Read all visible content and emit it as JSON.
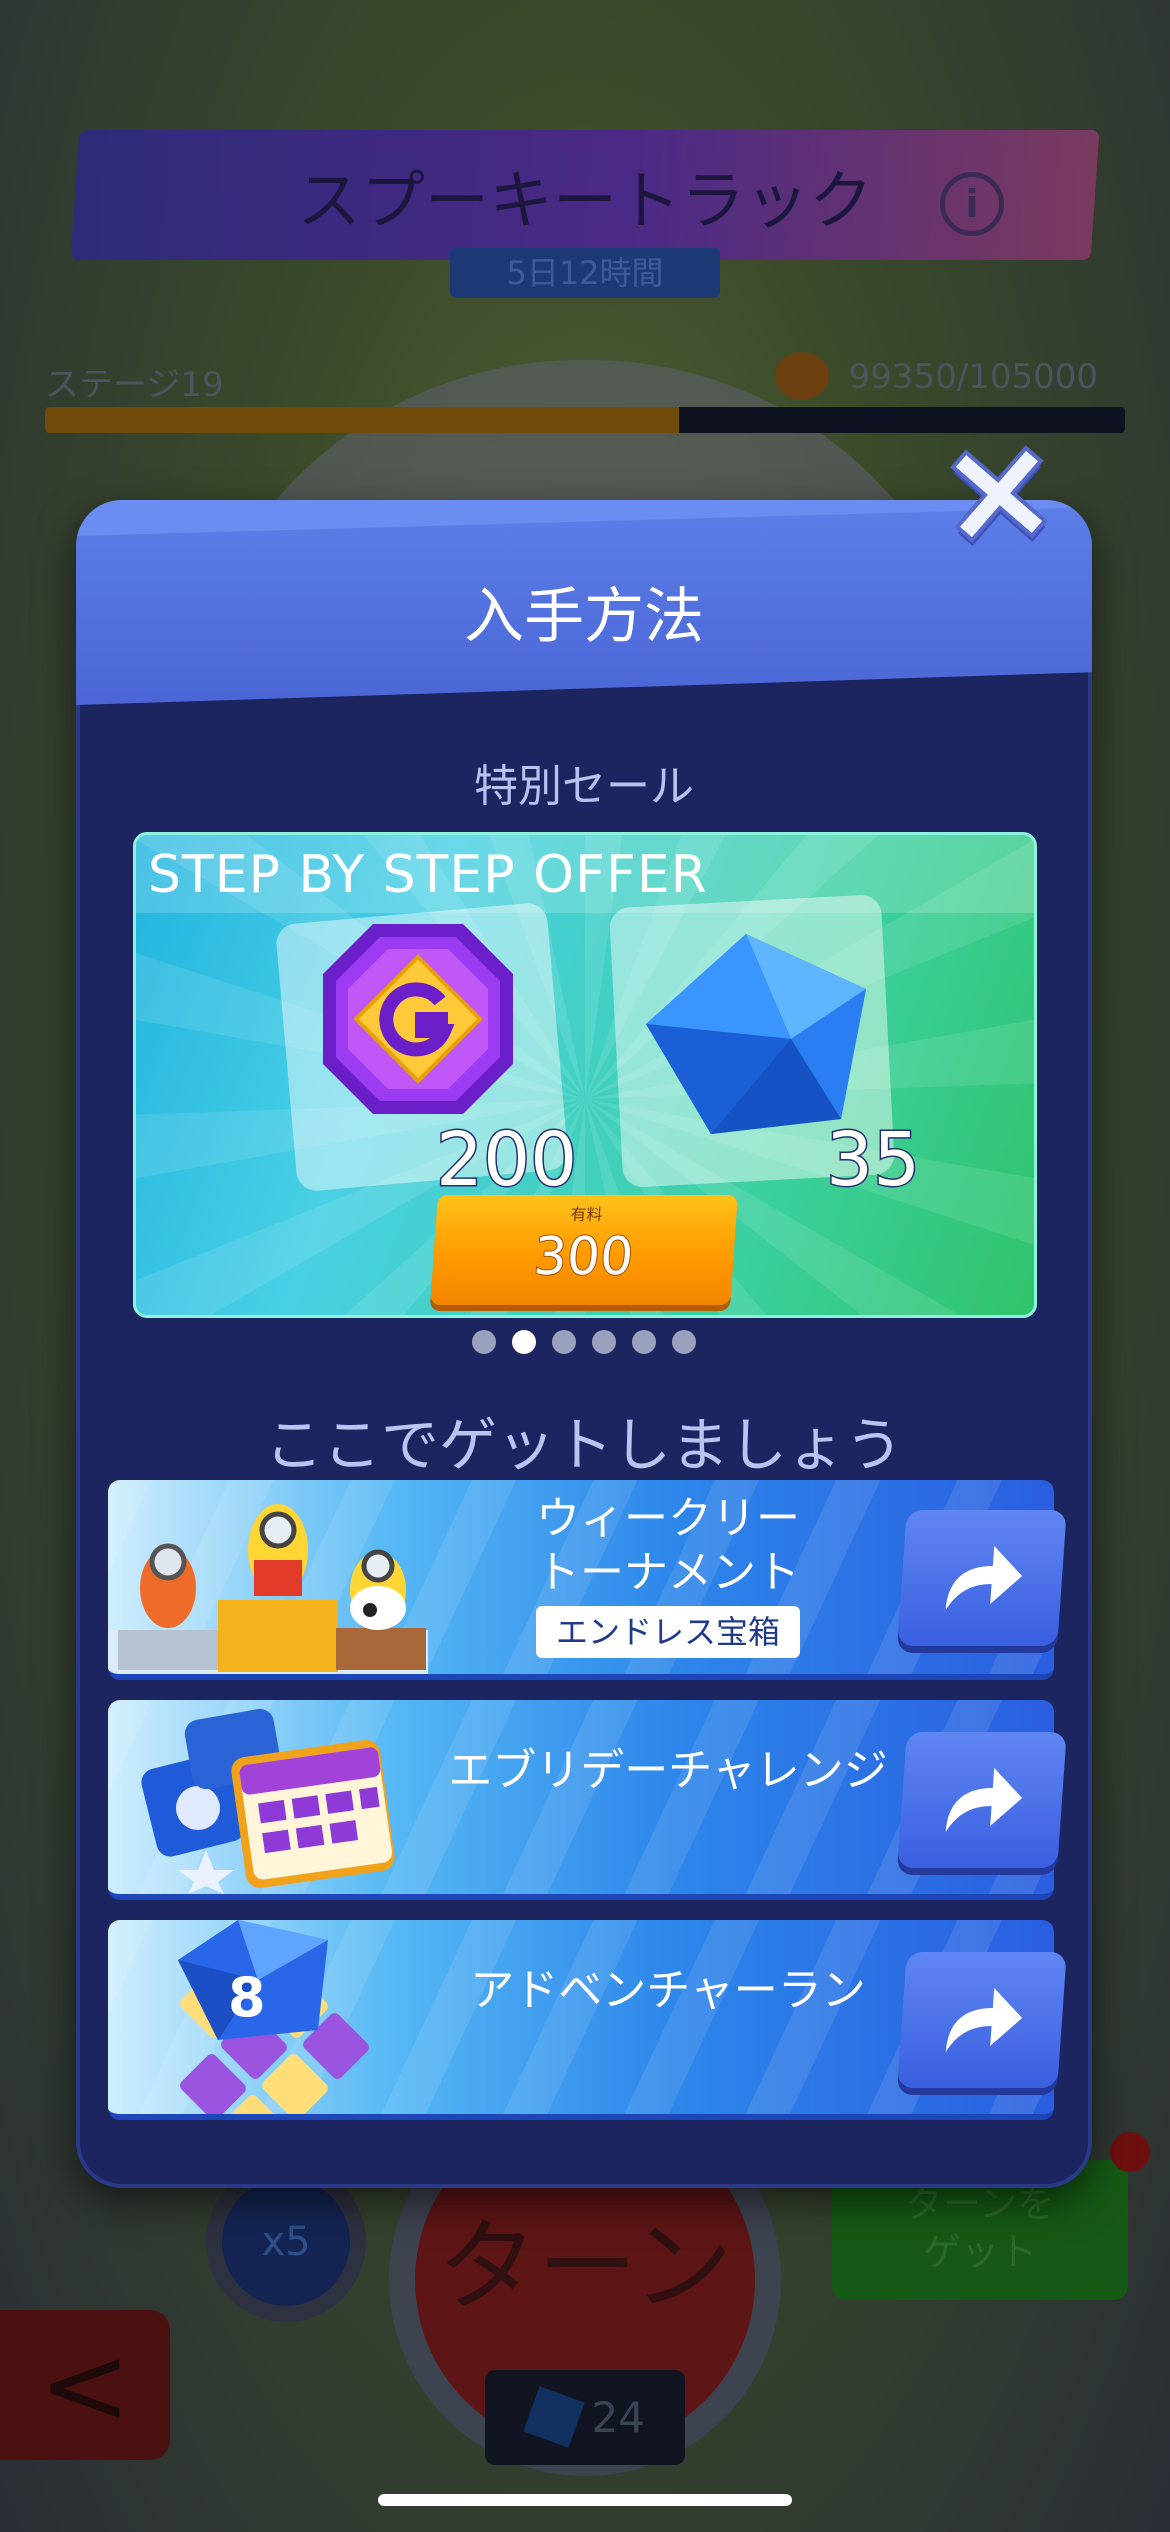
{
  "background": {
    "event_title": "スプーキートラック",
    "timer": "5日12時間",
    "stage": "ステージ19",
    "progress_text": "99350/105000",
    "progress": {
      "current": 99350,
      "goal": 105000
    },
    "turn_label": "ターン",
    "multiplier": "x5",
    "get_turn_label": "ターンを\nゲット",
    "dice_count": "24"
  },
  "modal": {
    "title": "入手方法",
    "special_sale": "特別セール",
    "offer": {
      "title": "STEP BY STEP OFFER",
      "item1_amount": "200",
      "item2_amount": "35",
      "price_label": "有料",
      "price_value": "300",
      "item1_icon": "gold-token-icon",
      "item2_icon": "blue-dice-icon"
    },
    "pager": {
      "count": 6,
      "active_index": 1
    },
    "get_here": "ここでゲットしましょう",
    "routes": [
      {
        "label": "ウィークリートーナメント",
        "badge": "エンドレス宝箱",
        "icon": "arrow-right-icon"
      },
      {
        "label": "エブリデーチャレンジ",
        "icon": "arrow-right-icon"
      },
      {
        "label": "アドベンチャーラン",
        "icon": "arrow-right-icon"
      }
    ]
  },
  "colors": {
    "modal_bg": "#1c2560",
    "header_blue": "#4a66d6",
    "price_orange": "#ff9a00",
    "route_blue": "#2a5ee0"
  }
}
